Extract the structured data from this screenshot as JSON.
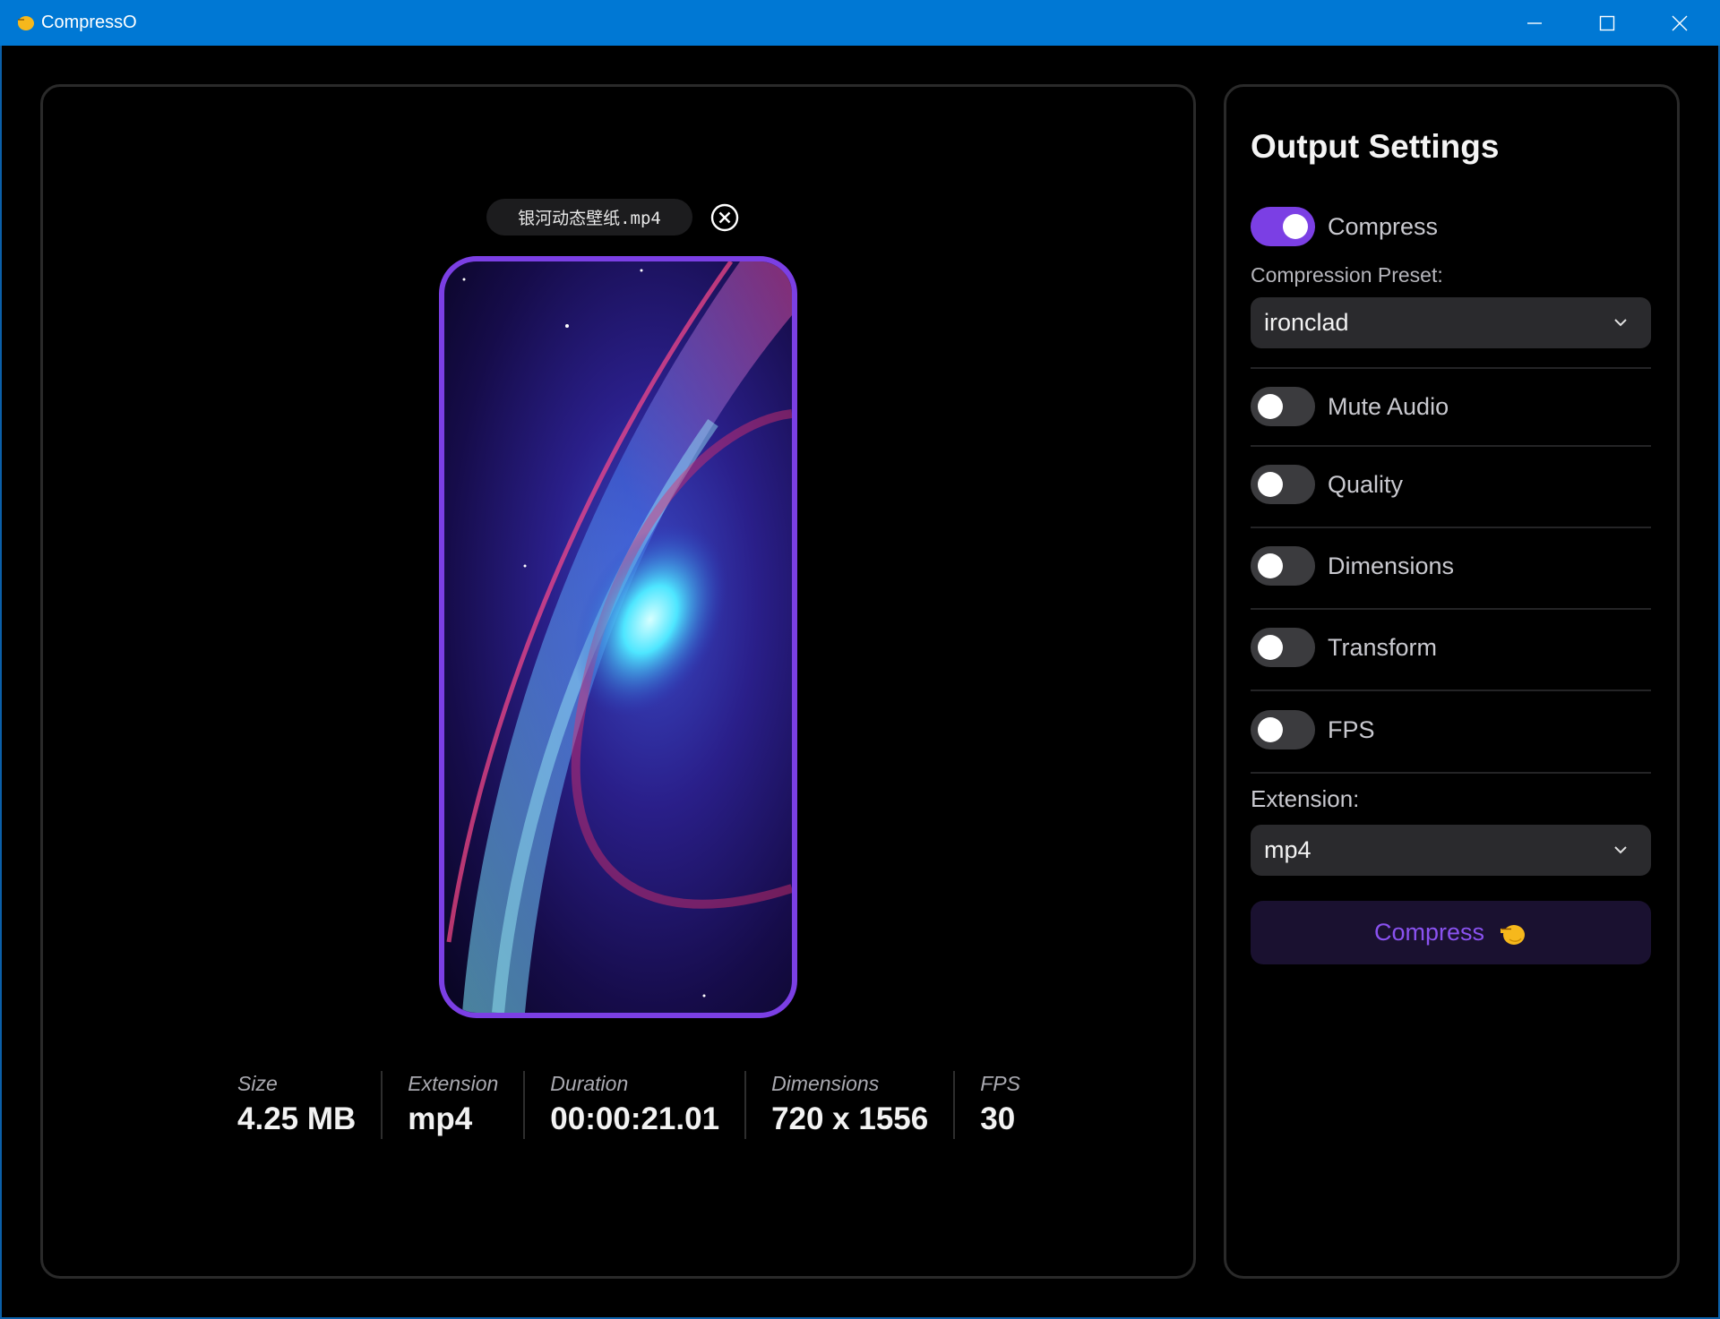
{
  "window": {
    "title": "CompressO",
    "icon": "compresso-hand-icon"
  },
  "file": {
    "name": "银河动态壁纸.mp4"
  },
  "metadata": [
    {
      "label": "Size",
      "value": "4.25 MB"
    },
    {
      "label": "Extension",
      "value": "mp4"
    },
    {
      "label": "Duration",
      "value": "00:00:21.01"
    },
    {
      "label": "Dimensions",
      "value": "720 x 1556"
    },
    {
      "label": "FPS",
      "value": "30"
    }
  ],
  "settings": {
    "title": "Output Settings",
    "compress_toggle": {
      "label": "Compress",
      "on": true
    },
    "preset": {
      "label": "Compression Preset:",
      "value": "ironclad"
    },
    "toggles": [
      {
        "label": "Mute Audio",
        "on": false
      },
      {
        "label": "Quality",
        "on": false
      },
      {
        "label": "Dimensions",
        "on": false
      },
      {
        "label": "Transform",
        "on": false
      },
      {
        "label": "FPS",
        "on": false
      }
    ],
    "extension": {
      "label": "Extension:",
      "value": "mp4"
    },
    "compress_button": "Compress"
  },
  "colors": {
    "titlebar": "#0078d4",
    "accent": "#7b3fe4",
    "button_bg": "#1a1130",
    "hand_yellow": "#f6b81c"
  }
}
